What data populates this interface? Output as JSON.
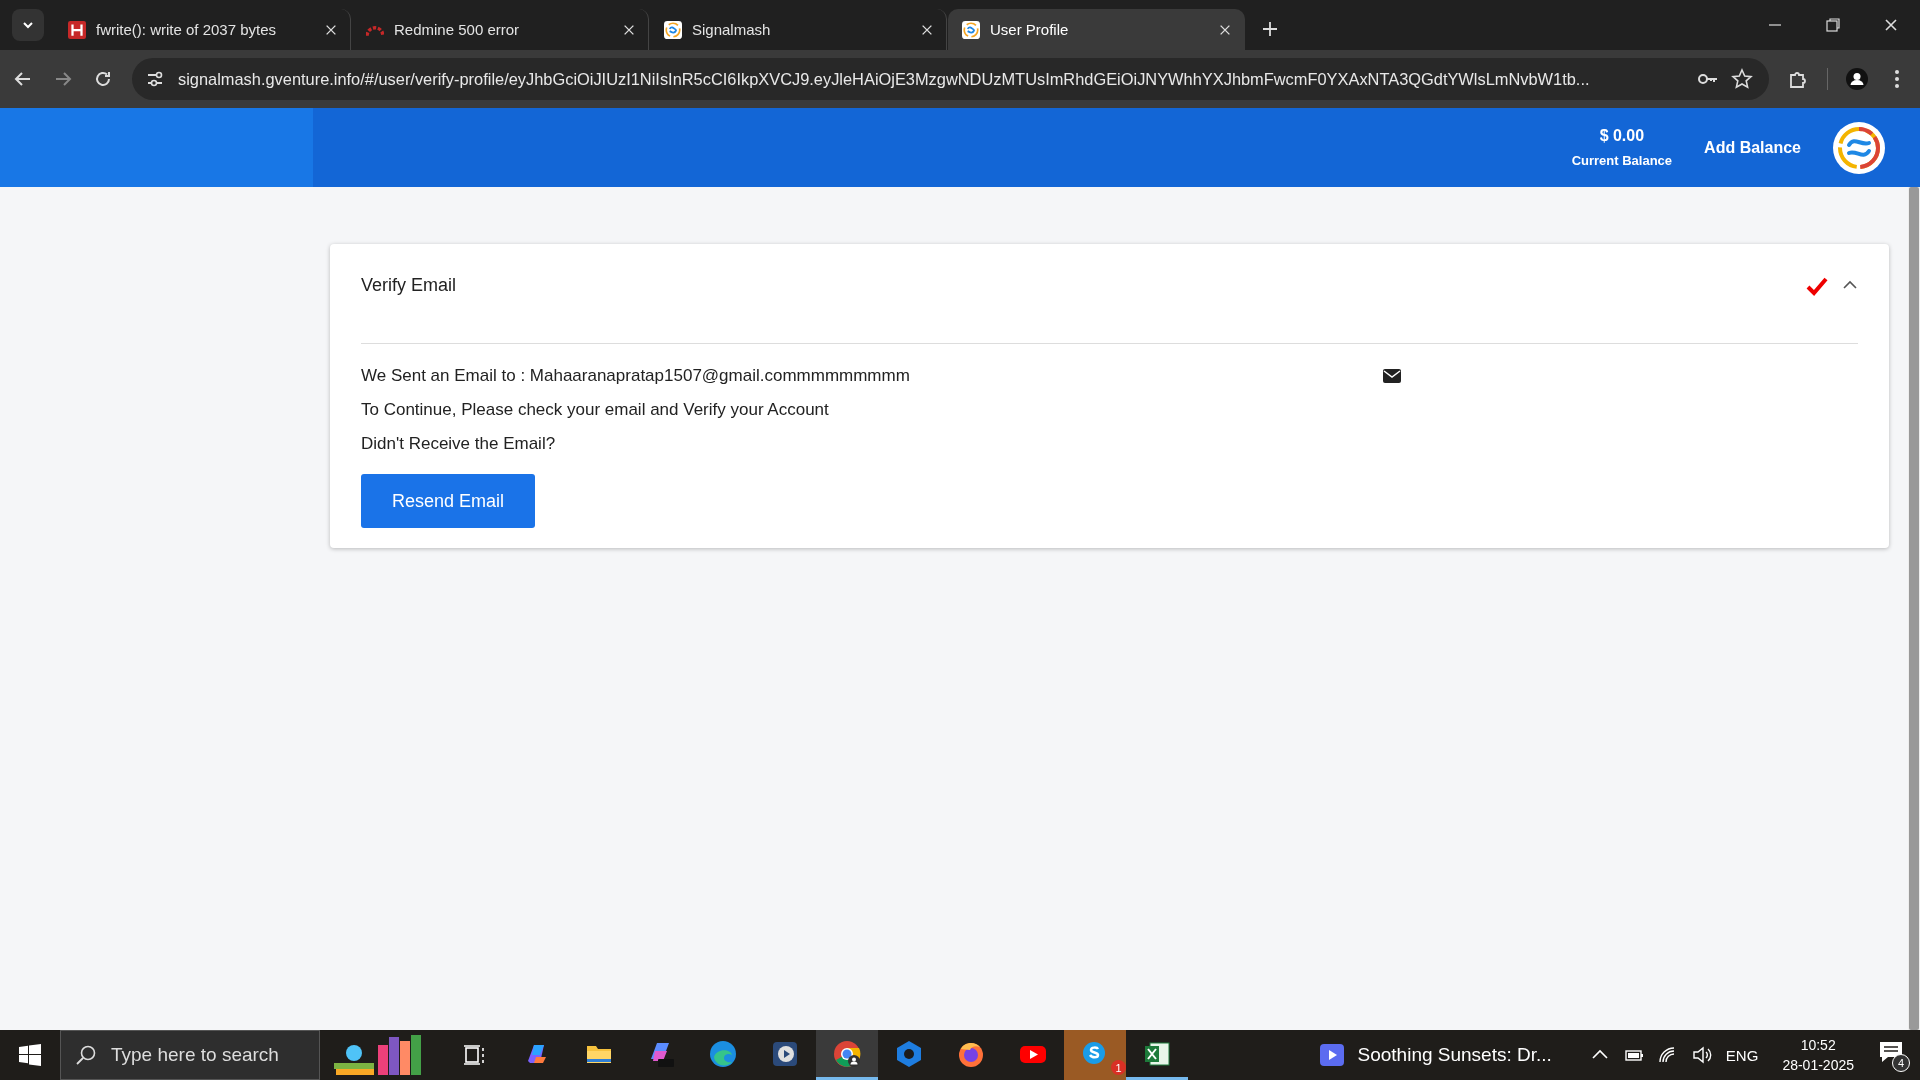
{
  "browser": {
    "tabs": [
      {
        "title": "fwrite(): write of 2037 bytes",
        "kind": "error-page",
        "selected": false
      },
      {
        "title": "Redmine 500 error",
        "kind": "redmine",
        "selected": false
      },
      {
        "title": "Signalmash",
        "kind": "signalmash",
        "selected": false
      },
      {
        "title": "User Profile",
        "kind": "signalmash",
        "selected": true
      }
    ],
    "address": "signalmash.gventure.info/#/user/verify-profile/eyJhbGciOiJIUzI1NiIsInR5cCI6IkpXVCJ9.eyJleHAiOjE3MzgwNDUzMTUsImRhdGEiOiJNYWhhYXJhbmFwcmF0YXAxNTA3QGdtYWlsLmNvbW1tb..."
  },
  "header": {
    "balance": "$ 0.00",
    "balance_label": "Current Balance",
    "add_balance": "Add Balance"
  },
  "card": {
    "title": "Verify Email",
    "verified": true,
    "expanded": true,
    "sent_to": "We Sent an Email to : Mahaaranapratap1507@gmail.commmmmmmmm",
    "instruction": "To Continue, Please check your email and Verify your Account",
    "question": "Didn't Receive the Email?",
    "button": "Resend Email"
  },
  "taskbar": {
    "search_placeholder": "Type here to search",
    "apps": [
      {
        "kind": "copilot",
        "active": false,
        "highlighted": false
      },
      {
        "kind": "folder",
        "active": false,
        "highlighted": false
      },
      {
        "kind": "m365",
        "active": false,
        "highlighted": false
      },
      {
        "kind": "edge",
        "active": false,
        "highlighted": false
      },
      {
        "kind": "media",
        "active": false,
        "highlighted": false
      },
      {
        "kind": "chrome",
        "active": true,
        "highlighted": true
      },
      {
        "kind": "hub",
        "active": false,
        "highlighted": false
      },
      {
        "kind": "firefox",
        "active": false,
        "highlighted": false
      },
      {
        "kind": "youtube",
        "active": false,
        "highlighted": false
      },
      {
        "kind": "skype",
        "active": false,
        "highlighted": true,
        "badge": "1"
      },
      {
        "kind": "excel",
        "active": true,
        "highlighted": false
      }
    ],
    "media_title": "Soothing Sunsets: Dr...",
    "language": "ENG",
    "time": "10:52",
    "date": "28-01-2025",
    "notifications": "4"
  }
}
